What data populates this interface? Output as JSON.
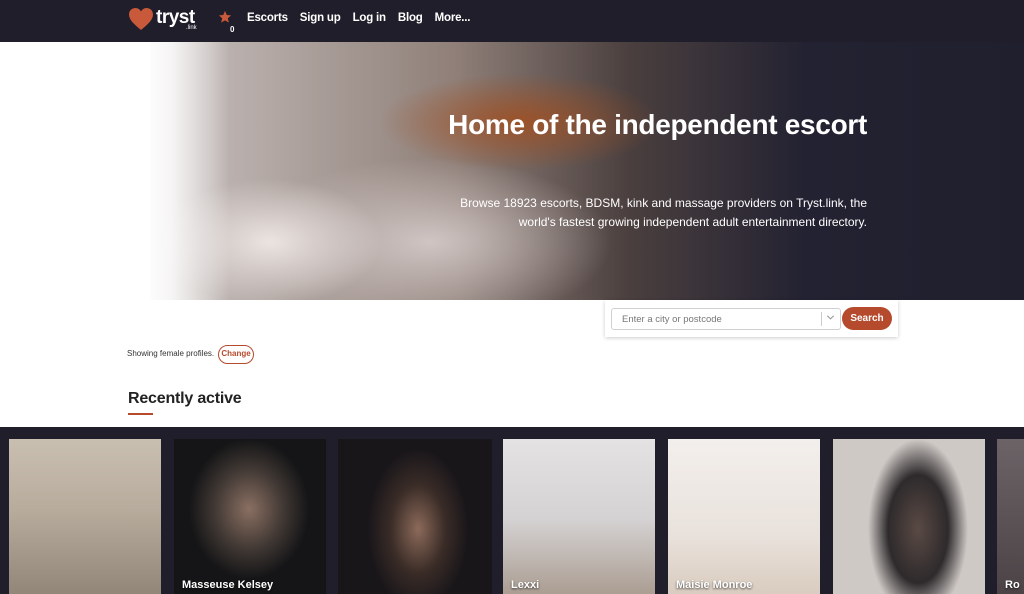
{
  "brand": {
    "name": "tryst",
    "sub": ".link",
    "accent": "#b54a2c",
    "nav_bg": "#1f1e2a"
  },
  "nav": {
    "favorites_icon": "star-icon",
    "favorites_count": "0",
    "links": [
      "Escorts",
      "Sign up",
      "Log in",
      "Blog",
      "More..."
    ]
  },
  "hero": {
    "title": "Home of the independent escort",
    "description": "Browse 18923 escorts, BDSM, kink and massage providers on Tryst.link, the world's fastest growing independent adult entertainment directory."
  },
  "search": {
    "placeholder": "Enter a city or postcode",
    "button_label": "Search"
  },
  "filter": {
    "showing_text": "Showing female profiles.",
    "change_label": "Change"
  },
  "recent": {
    "title": "Recently active",
    "cards": [
      {
        "name": ""
      },
      {
        "name": "Masseuse Kelsey"
      },
      {
        "name": ""
      },
      {
        "name": "Lexxi"
      },
      {
        "name": "Maisie Monroe"
      },
      {
        "name": ""
      },
      {
        "name": "Ro"
      }
    ]
  }
}
